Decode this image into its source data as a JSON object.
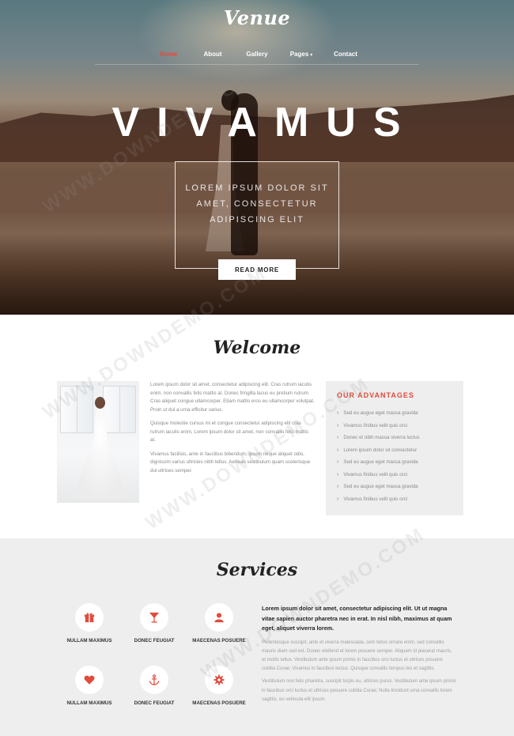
{
  "brand": {
    "logo": "Venue"
  },
  "nav": {
    "items": [
      {
        "label": "Home",
        "active": true
      },
      {
        "label": "About"
      },
      {
        "label": "Gallery"
      },
      {
        "label": "Pages",
        "dropdown": true
      },
      {
        "label": "Contact"
      }
    ],
    "dropdown_caret": "▾"
  },
  "hero": {
    "title": "VIVAMUS",
    "subtitle": "LOREM IPSUM DOLOR SIT AMET, CONSECTETUR ADIPISCING ELIT",
    "button_label": "READ MORE"
  },
  "welcome": {
    "title": "Welcome",
    "paragraphs": [
      "Lorem ipsum dolor sit amet, consectetur adipiscing elit. Cras rutrum iaculis enim, non convallis felis mattis at. Donec fringilla lacus eu pretium rutrum. Cras aliquet congue ullamcorper. Etiam mattis eros eu ullamcorper volutpat. Proin ut dui a urna efficitur varius.",
      "Quisque molestie cursus mi et congue consectetur adipiscing elit cras rutrum iaculis enim, Lorem ipsum dolor sit amet, non convallis felis mattis at.",
      "Vivamus facilisis, ante in faucibus bibendum, ipsum neque aliquet odio, dignissim varius ultricies nibh tellus. Aenean vestibulum quam scelerisque dui ultrices semper."
    ]
  },
  "advantages": {
    "title": "OUR ADVANTAGES",
    "items": [
      "Sed eu augue eget massa gravida",
      "Vivamus finibus velit quis orci",
      "Donec et nibh massa viverra luctus",
      "Lorem ipsum dolor sit consectetur",
      "Sed eu augue eget massa gravida",
      "Vivamus finibus velit quis orci",
      "Sed eu augue eget massa gravida",
      "Vivamus finibus velit quis orci"
    ]
  },
  "services": {
    "title": "Services",
    "items": [
      {
        "label": "NULLAM MAXIMUS",
        "icon": "gift-icon"
      },
      {
        "label": "DONEC FEUGIAT",
        "icon": "cocktail-icon"
      },
      {
        "label": "MAECENAS POSUERE",
        "icon": "user-icon"
      },
      {
        "label": "NULLAM MAXIMUS",
        "icon": "heart-icon"
      },
      {
        "label": "DONEC FEUGIAT",
        "icon": "anchor-icon"
      },
      {
        "label": "MAECENAS POSUERE",
        "icon": "gear-icon"
      }
    ],
    "lead": "Lorem ipsum dolor sit amet, consectetur adipiscing elit. Ut ut magna vitae sapien auctor pharetra nec in erat. In nisl nibh, maximus at quam eget, aliquet viverra lorem.",
    "body": [
      "Pellentesque suscipit, ante et viverra malesuada, sem tellus ornare enim, sed convallis mauris diam sed est. Donec eleifend et lorem posuere semper. Aliquam id placerat mauris, et mollis tellus. Vestibulum ante ipsum primis in faucibus orci luctus et ultrices posuere cubilia Curae; Vivamus in faucibus lectus. Quisque convallis tempus leo et sagittis.",
      "Vestibulum non felis pharetra, suscipit turpis eu, ultrices purus. Vestibulum ante ipsum primis in faucibus orci luctus et ultrices posuere cubilia Curae; Nulla tincidunt urna convallis lorem sagittis, eu vehicula elit ipsum."
    ]
  },
  "watermark": {
    "text": "WWW.DOWNDEMO.COM"
  },
  "colors": {
    "accent": "#e24a3b",
    "panel": "#eeeeee",
    "text_muted": "#8a8a8a"
  }
}
